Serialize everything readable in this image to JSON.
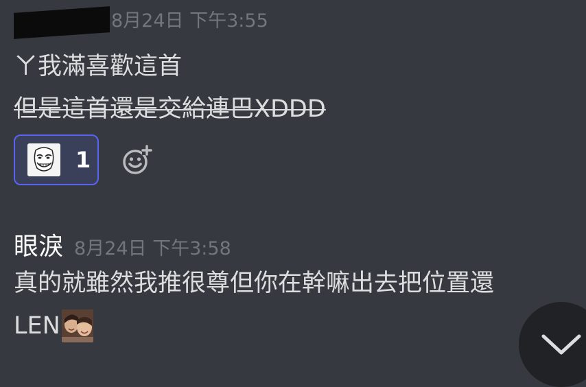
{
  "messages": [
    {
      "author_redacted": true,
      "timestamp": "8月24日 下午3:55",
      "lines": [
        {
          "text": "ㄚ我滿喜歡這首",
          "strikethrough": false
        },
        {
          "text": "但是這首還是交給連巴XDDD",
          "strikethrough": true
        }
      ],
      "reactions": [
        {
          "emoji": "troll-face-custom-emoji",
          "count": "1",
          "selected": true
        }
      ],
      "add_reaction_icon": "add-reaction-smile-plus-icon"
    },
    {
      "author": "眼淚",
      "timestamp": "8月24日 下午3:58",
      "lines": [
        {
          "text": "真的就雖然我推很尊但你在幹嘛出去把位置還"
        },
        {
          "text": "LEN",
          "trailing_emoji": "custom-photo-emoji"
        }
      ]
    }
  ],
  "scroll_to_bottom": {
    "icon": "chevron-down-icon"
  },
  "colors": {
    "background": "#36393f",
    "text": "#dcddde",
    "username": "#ffffff",
    "timestamp": "#72767d",
    "reaction_border": "#5865f2",
    "reaction_bg": "#3b405a",
    "scroll_button_bg": "#202225"
  }
}
